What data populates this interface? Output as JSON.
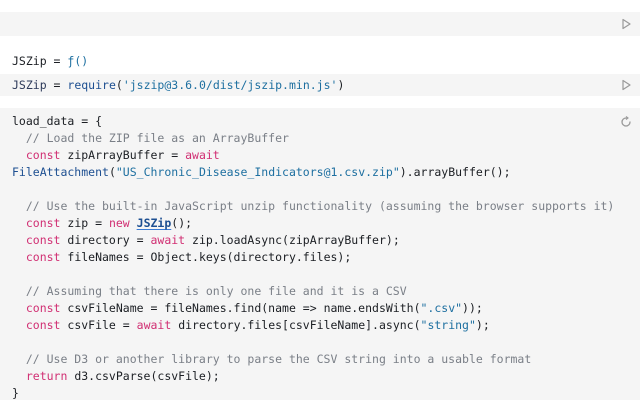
{
  "cell1": {
    "run_icon": "play-icon"
  },
  "cell2": {
    "output": {
      "name": "JSZip",
      "eq": " = ",
      "value": "ƒ()"
    },
    "code": {
      "name": "JSZip",
      "eq": " = ",
      "fn": "require",
      "arg": "'jszip@3.6.0/dist/jszip.min.js'"
    },
    "run_icon": "play-icon"
  },
  "cell3": {
    "status_icon": "spinner-icon",
    "lines": {
      "l1": "load_data = {",
      "l2": "  // Load the ZIP file as an ArrayBuffer",
      "l3_kw": "  const ",
      "l3_rest": "zipArrayBuffer = ",
      "l3_await": "await",
      "l4_fn": "FileAttachment",
      "l4_str": "\"US_Chronic_Disease_Indicators@1.csv.zip\"",
      "l4_rest": ").arrayBuffer();",
      "l6": "  // Use the built-in JavaScript unzip functionality (assuming the browser supports it)",
      "l7_kw": "  const ",
      "l7_rest": "zip = ",
      "l7_new": "new ",
      "l7_cls": "JSZip",
      "l7_end": "();",
      "l8_kw": "  const ",
      "l8_rest": "directory = ",
      "l8_await": "await ",
      "l8_end": "zip.loadAsync(zipArrayBuffer);",
      "l9_kw": "  const ",
      "l9_rest": "fileNames = Object.keys(directory.files);",
      "l11": "  // Assuming that there is only one file and it is a CSV",
      "l12_kw": "  const ",
      "l12_rest": "csvFileName = fileNames.find(name => name.endsWith(",
      "l12_str": "\".csv\"",
      "l12_end": "));",
      "l13_kw": "  const ",
      "l13_rest": "csvFile = ",
      "l13_await": "await ",
      "l13_mid": "directory.files[csvFileName].async(",
      "l13_str": "\"string\"",
      "l13_end": ");",
      "l15": "  // Use D3 or another library to parse the CSV string into a usable format",
      "l16_kw": "  return ",
      "l16_rest": "d3.csvParse(csvFile);",
      "l17": "}"
    }
  }
}
